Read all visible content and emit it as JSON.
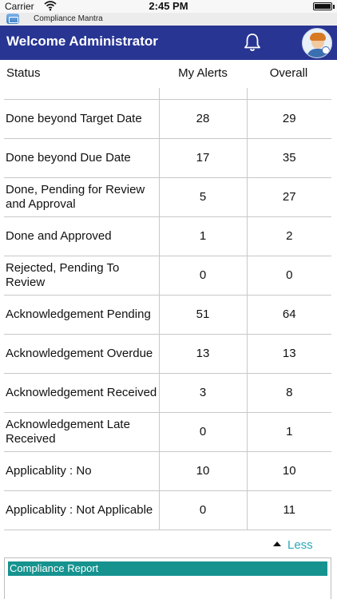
{
  "status_bar": {
    "carrier": "Carrier",
    "time": "2:45 PM"
  },
  "app": {
    "name": "Compliance Mantra"
  },
  "header": {
    "welcome": "Welcome Administrator",
    "bell_icon": "bell-icon",
    "avatar_icon": "user-avatar"
  },
  "columns": {
    "status": "Status",
    "my_alerts": "My Alerts",
    "overall": "Overall"
  },
  "rows": [
    {
      "status": "Done beyond Target Date",
      "my_alerts": "28",
      "overall": "29"
    },
    {
      "status": "Done beyond Due Date",
      "my_alerts": "17",
      "overall": "35"
    },
    {
      "status": "Done, Pending for Review and Approval",
      "my_alerts": "5",
      "overall": "27"
    },
    {
      "status": "Done and Approved",
      "my_alerts": "1",
      "overall": "2"
    },
    {
      "status": "Rejected, Pending To Review",
      "my_alerts": "0",
      "overall": "0"
    },
    {
      "status": "Acknowledgement Pending",
      "my_alerts": "51",
      "overall": "64"
    },
    {
      "status": "Acknowledgement Overdue",
      "my_alerts": "13",
      "overall": "13"
    },
    {
      "status": "Acknowledgement Received",
      "my_alerts": "3",
      "overall": "8"
    },
    {
      "status": "Acknowledgement Late Received",
      "my_alerts": "0",
      "overall": "1"
    },
    {
      "status": "Applicablity : No",
      "my_alerts": "10",
      "overall": "10"
    },
    {
      "status": "Applicablity : Not Applicable",
      "my_alerts": "0",
      "overall": "11"
    }
  ],
  "less_label": "Less",
  "report": {
    "title": "Compliance Report"
  },
  "colors": {
    "header_bg": "#283593",
    "accent_teal": "#16938f",
    "link": "#2aa8b8"
  }
}
